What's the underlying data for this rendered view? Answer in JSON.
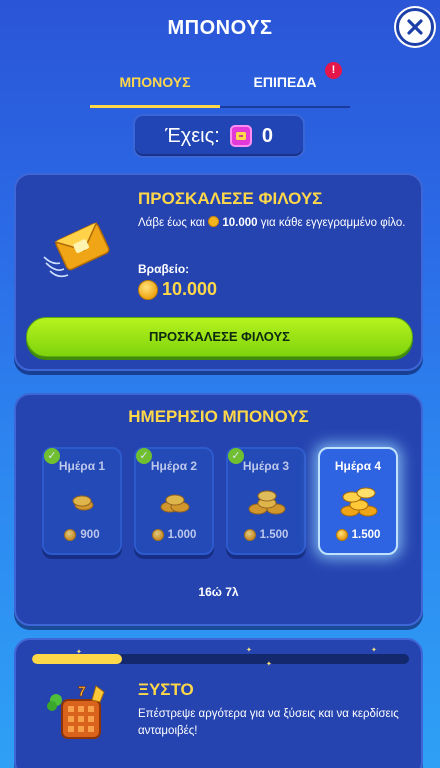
{
  "header": {
    "title": "ΜΠΟΝΟΥΣ",
    "close_icon": "close-icon"
  },
  "tabs": [
    {
      "label": "ΜΠΟΝΟΥΣ",
      "active": true
    },
    {
      "label": "ΕΠΙΠΕΔΑ",
      "active": false,
      "alert": "!"
    }
  ],
  "balance": {
    "label": "Έχεις:",
    "icon": "ticket-icon",
    "value": "0"
  },
  "invite": {
    "title": "ΠΡΟΣΚΑΛΕΣΕ ΦΙΛΟΥΣ",
    "desc_before": "Λάβε έως και",
    "desc_amount": "10.000",
    "desc_after": "για κάθε εγγεγραμμένο φίλο.",
    "prize_label": "Βραβείο:",
    "prize_value": "10.000",
    "button_label": "ΠΡΟΣΚΑΛΕΣΕ ΦΙΛΟΥΣ"
  },
  "daily": {
    "title": "ΗΜΕΡΗΣΙΟ ΜΠΟΝΟΥΣ",
    "days": [
      {
        "label": "Ημέρα 1",
        "amount": "900",
        "state": "claimed"
      },
      {
        "label": "Ημέρα 2",
        "amount": "1.000",
        "state": "claimed"
      },
      {
        "label": "Ημέρα 3",
        "amount": "1.500",
        "state": "claimed"
      },
      {
        "label": "Ημέρα 4",
        "amount": "1.500",
        "state": "current"
      }
    ],
    "timer": "16ώ 7λ"
  },
  "scratch": {
    "progress": 0.24,
    "title": "ΞΥΣΤΟ",
    "desc": "Επέστρεψε αργότερα για να ξύσεις και να κερδίσεις ανταμοιβές!"
  },
  "colors": {
    "accent_yellow": "#ffd84a",
    "button_green": "#8fe012",
    "card_blue": "#2544b0"
  }
}
